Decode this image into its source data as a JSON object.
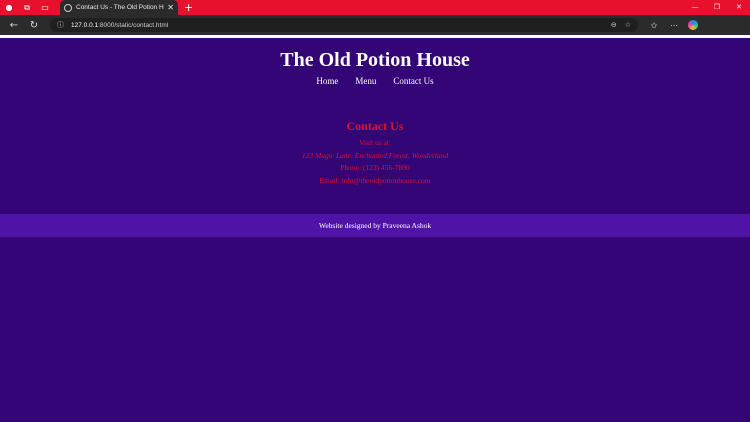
{
  "browser": {
    "tab_title": "Contact Us - The Old Potion House",
    "url_host": "127.0.0.1",
    "url_rest": ":8000/static/contact.html",
    "new_tab": "+",
    "tab_close": "✕"
  },
  "site": {
    "title": "The Old Potion House",
    "nav": [
      "Home",
      "Menu",
      "Contact Us"
    ]
  },
  "contact": {
    "heading": "Contact Us",
    "visit_label": "Visit us at:",
    "address": "123 Magic Lane, Enchanted Forest, Wonderland",
    "phone": "Phone: (123) 456-7890",
    "email": "Email: info@theoldpotionhouse.com"
  },
  "footer": {
    "credit": "Website designed by Praveena Ashok"
  },
  "colors": {
    "page_bg": "#330577",
    "footer_bg": "#5013a8",
    "accent_red": "#e0142c",
    "tabbar": "#e8112d"
  }
}
